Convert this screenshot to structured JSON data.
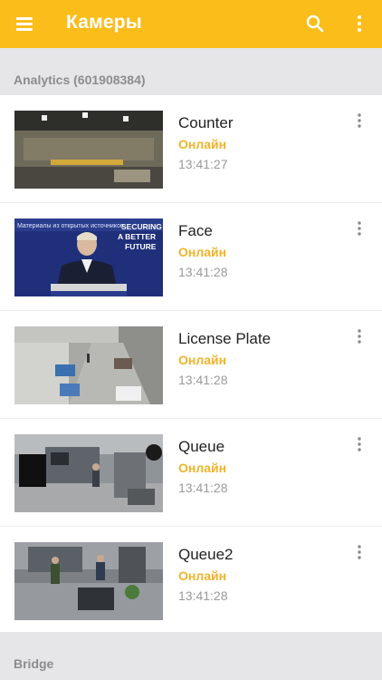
{
  "appbar": {
    "title": "Камеры",
    "accent_color": "#fbbd1a",
    "icons": [
      "menu-icon",
      "search-icon",
      "more-vert-icon"
    ]
  },
  "groups": [
    {
      "label": "Analytics (601908384)"
    },
    {
      "label": "Bridge"
    }
  ],
  "cameras": [
    {
      "name": "Counter",
      "status": "Онлайн",
      "time": "13:41:27"
    },
    {
      "name": "Face",
      "status": "Онлайн",
      "time": "13:41:28"
    },
    {
      "name": "License Plate",
      "status": "Онлайн",
      "time": "13:41:28"
    },
    {
      "name": "Queue",
      "status": "Онлайн",
      "time": "13:41:28"
    },
    {
      "name": "Queue2",
      "status": "Онлайн",
      "time": "13:41:28"
    }
  ],
  "thumb_texts": {
    "face_overlay": "Материалы из открытых источников",
    "face_slogan": [
      "SECURING",
      "A BETTER",
      "FUTURE"
    ]
  },
  "status_color": "#f0b32a"
}
